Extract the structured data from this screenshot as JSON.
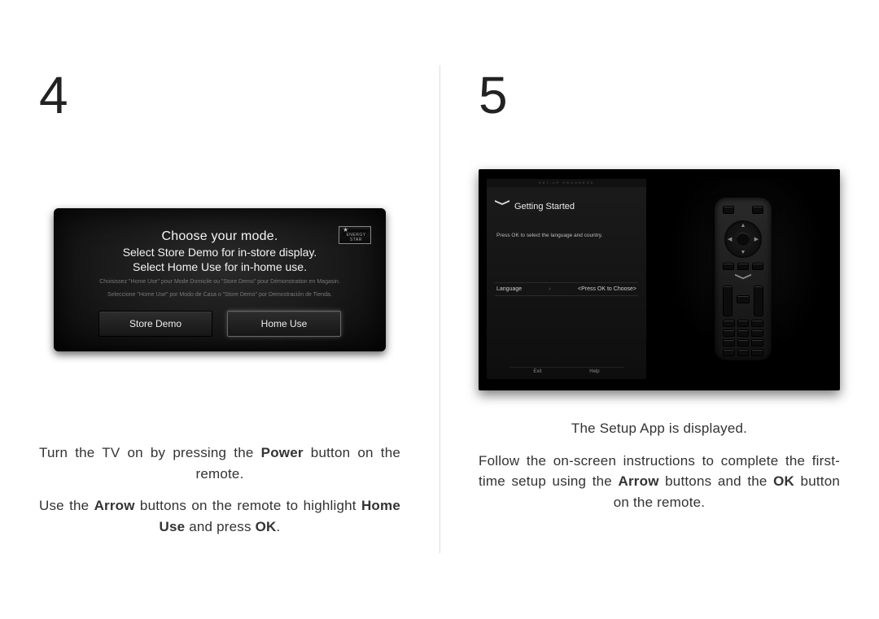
{
  "left": {
    "number": "4",
    "figure": {
      "title": "Choose your mode.",
      "sub1": "Select Store Demo for in-store display.",
      "sub2": "Select Home Use for in-home use.",
      "fine1": "Choisissez \"Home Use\" pour Mode Domicile ou \"Store Demo\" pour Démonstration en Magasin.",
      "fine2": "Seleccione \"Home Use\" por Modo de Casa o \"Store Demo\" por Demostración de Tienda.",
      "btn_store": "Store Demo",
      "btn_home": "Home Use",
      "badge": "ENERGY STAR"
    },
    "para1_a": "Turn the TV on by pressing the ",
    "para1_b": "Power",
    "para1_c": " button on the remote.",
    "para2_a": "Use the ",
    "para2_b": "Arrow",
    "para2_c": " buttons on the remote to highlight ",
    "para2_d": "Home Use",
    "para2_e": " and press ",
    "para2_f": "OK",
    "para2_g": "."
  },
  "right": {
    "number": "5",
    "figure": {
      "band": "SET-UP  PROGRESS",
      "title": "Getting Started",
      "hint": "Press OK to select the language and country.",
      "row_label": "Language",
      "row_value": "<Press OK to Choose>",
      "footer_exit": "Exit",
      "footer_help": "Help"
    },
    "para1": "The Setup App is displayed.",
    "para2_a": "Follow the on-screen instructions to complete the first-time setup using the ",
    "para2_b": "Arrow",
    "para2_c": " buttons and the ",
    "para2_d": "OK",
    "para2_e": " button on the remote."
  }
}
